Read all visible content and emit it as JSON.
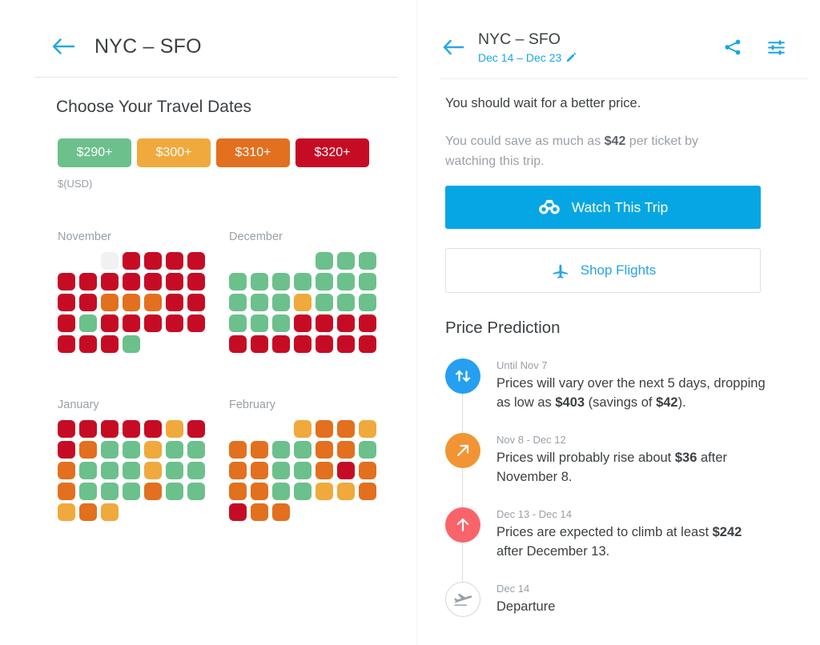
{
  "left": {
    "back_icon": "back-arrow-icon",
    "title": "NYC – SFO",
    "heading": "Choose Your Travel Dates",
    "legend": [
      {
        "label": "$290+",
        "color": "#6cc08b"
      },
      {
        "label": "$300+",
        "color": "#f0a93c"
      },
      {
        "label": "$310+",
        "color": "#e2701e"
      },
      {
        "label": "$320+",
        "color": "#c60c25"
      }
    ],
    "unit_label": "$(USD)",
    "months": [
      {
        "name": "November",
        "rows": [
          [
            "empty",
            "empty",
            "gray",
            "red",
            "red",
            "red",
            "red"
          ],
          [
            "red",
            "red",
            "red",
            "red",
            "red",
            "red",
            "red"
          ],
          [
            "red",
            "red",
            "orange",
            "orange",
            "orange",
            "red",
            "red"
          ],
          [
            "red",
            "green",
            "red",
            "red",
            "red",
            "red",
            "red"
          ],
          [
            "red",
            "red",
            "red",
            "green"
          ]
        ]
      },
      {
        "name": "December",
        "rows": [
          [
            "empty",
            "empty",
            "empty",
            "empty",
            "green",
            "green",
            "green"
          ],
          [
            "green",
            "green",
            "green",
            "green",
            "green",
            "green",
            "green"
          ],
          [
            "green",
            "green",
            "green",
            "yellow",
            "green",
            "green",
            "green"
          ],
          [
            "green",
            "green",
            "green",
            "red",
            "red",
            "red",
            "red"
          ],
          [
            "red",
            "red",
            "red",
            "red",
            "red",
            "red",
            "red"
          ]
        ]
      },
      {
        "name": "January",
        "rows": [
          [
            "red",
            "red",
            "red",
            "red",
            "red",
            "yellow",
            "red"
          ],
          [
            "red",
            "orange",
            "green",
            "green",
            "yellow",
            "green",
            "green"
          ],
          [
            "orange",
            "green",
            "green",
            "green",
            "yellow",
            "green",
            "green"
          ],
          [
            "orange",
            "green",
            "green",
            "green",
            "orange",
            "green",
            "green"
          ],
          [
            "yellow",
            "orange",
            "yellow"
          ]
        ]
      },
      {
        "name": "February",
        "rows": [
          [
            "empty",
            "empty",
            "empty",
            "yellow",
            "orange",
            "orange",
            "yellow"
          ],
          [
            "orange",
            "orange",
            "green",
            "green",
            "orange",
            "orange",
            "green"
          ],
          [
            "orange",
            "orange",
            "green",
            "green",
            "orange",
            "red",
            "orange"
          ],
          [
            "orange",
            "orange",
            "green",
            "green",
            "yellow",
            "yellow",
            "orange"
          ],
          [
            "red",
            "orange",
            "orange"
          ]
        ]
      }
    ]
  },
  "right": {
    "back_icon": "back-arrow-icon",
    "title": "NYC – SFO",
    "date_range": "Dec 14 – Dec 23",
    "edit_icon": "pencil-icon",
    "share_icon": "share-icon",
    "filter_icon": "tune-sliders-icon",
    "advice": "You should wait for a better price.",
    "savings_prefix": "You could save as much as ",
    "savings_amount": "$42",
    "savings_suffix": " per ticket by watching this trip.",
    "watch_button": {
      "label": "Watch This Trip",
      "icon": "binoculars-icon",
      "color": "#06a6e4"
    },
    "shop_button": {
      "label": "Shop Flights",
      "icon": "airplane-icon",
      "color": "#26a3e8"
    },
    "prediction_heading": "Price Prediction",
    "timeline": [
      {
        "date": "Until Nov 7",
        "icon": "arrows-up-down-icon",
        "color": "#259ff0",
        "text_parts": [
          {
            "t": "Prices will vary over the next 5 days, dropping as low as ",
            "b": false
          },
          {
            "t": "$403",
            "b": true
          },
          {
            "t": " (savings of ",
            "b": false
          },
          {
            "t": "$42",
            "b": true
          },
          {
            "t": ").",
            "b": false
          }
        ]
      },
      {
        "date": "Nov 8 - Dec 12",
        "icon": "arrow-up-right-icon",
        "color": "#f29434",
        "text_parts": [
          {
            "t": "Prices will probably rise about ",
            "b": false
          },
          {
            "t": "$36",
            "b": true
          },
          {
            "t": " after November 8.",
            "b": false
          }
        ]
      },
      {
        "date": "Dec 13 - Dec 14",
        "icon": "arrow-up-icon",
        "color": "#f9646a",
        "text_parts": [
          {
            "t": "Prices are expected to climb at least ",
            "b": false
          },
          {
            "t": "$242",
            "b": true
          },
          {
            "t": " after December 13.",
            "b": false
          }
        ]
      },
      {
        "date": "Dec 14",
        "icon": "airplane-depart-icon",
        "color": "#ffffff",
        "text_parts": [
          {
            "t": "Departure",
            "b": false
          }
        ]
      }
    ]
  }
}
